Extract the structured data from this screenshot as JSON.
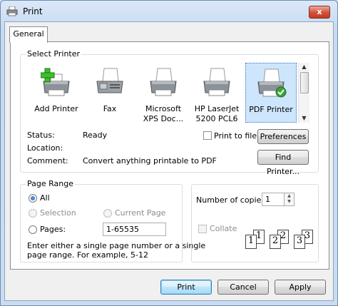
{
  "window": {
    "title": "Print",
    "close_label": "x"
  },
  "tabs": [
    {
      "label": "General"
    }
  ],
  "select_printer": {
    "legend": "Select Printer",
    "printers": [
      {
        "label_line1": "Add Printer",
        "label_line2": ""
      },
      {
        "label_line1": "Fax",
        "label_line2": ""
      },
      {
        "label_line1": "Microsoft",
        "label_line2": "XPS Doc..."
      },
      {
        "label_line1": "HP LaserJet",
        "label_line2": "5200 PCL6"
      },
      {
        "label_line1": "PDF Printer",
        "label_line2": ""
      }
    ],
    "selected_printer": "PDF Printer",
    "status_label": "Status:",
    "status_value": "Ready",
    "location_label": "Location:",
    "location_value": "",
    "comment_label": "Comment:",
    "comment_value": "Convert anything printable to PDF",
    "print_to_file_label": "Print to file",
    "print_to_file_checked": false,
    "preferences_label": "Preferences",
    "find_printer_label": "Find Printer..."
  },
  "page_range": {
    "legend": "Page Range",
    "all_label": "All",
    "selection_label": "Selection",
    "current_page_label": "Current Page",
    "pages_label": "Pages:",
    "pages_value": "1-65535",
    "selected_option": "All",
    "help_text_line1": "Enter either a single page number or a single",
    "help_text_line2": "page range.  For example, 5-12"
  },
  "copies": {
    "label": "Number of copies:",
    "value": "1",
    "collate_label": "Collate",
    "collate_checked": false,
    "collate_sets": [
      {
        "back": "1",
        "front": "1"
      },
      {
        "back": "2",
        "front": "2"
      },
      {
        "back": "3",
        "front": "3"
      }
    ]
  },
  "buttons": {
    "print": "Print",
    "cancel": "Cancel",
    "apply": "Apply"
  },
  "colors": {
    "accent": "#3c7fb1",
    "selection": "#cde6fb",
    "add_plus": "#3cbf2a",
    "pdf_check": "#3aa338"
  }
}
